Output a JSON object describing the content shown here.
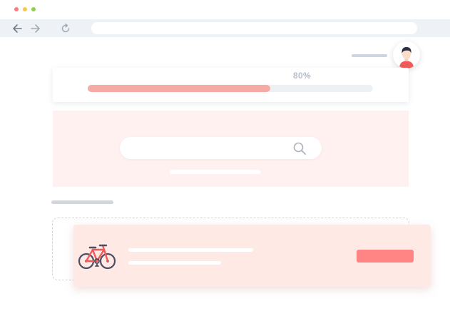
{
  "window": {
    "traffic_lights": [
      {
        "name": "close",
        "color": "#f87e7e"
      },
      {
        "name": "minimize",
        "color": "#f5c84a"
      },
      {
        "name": "maximize",
        "color": "#8dd24a"
      }
    ]
  },
  "toolbar": {
    "back_icon": "arrow-left-icon",
    "forward_icon": "arrow-right-icon",
    "reload_icon": "reload-icon",
    "url": ""
  },
  "user": {
    "avatar_icon": "user-avatar-icon"
  },
  "progress": {
    "label": "80%",
    "value": 0.8,
    "fill_color": "#f5aaa6"
  },
  "search": {
    "placeholder": "",
    "icon": "search-icon"
  },
  "item": {
    "icon": "bicycle-icon",
    "action_label": "",
    "button_color": "#ff8585"
  },
  "colors": {
    "accent": "#ff8585",
    "hero_background": "#fff1ef",
    "card_background": "#ffe9e5"
  }
}
